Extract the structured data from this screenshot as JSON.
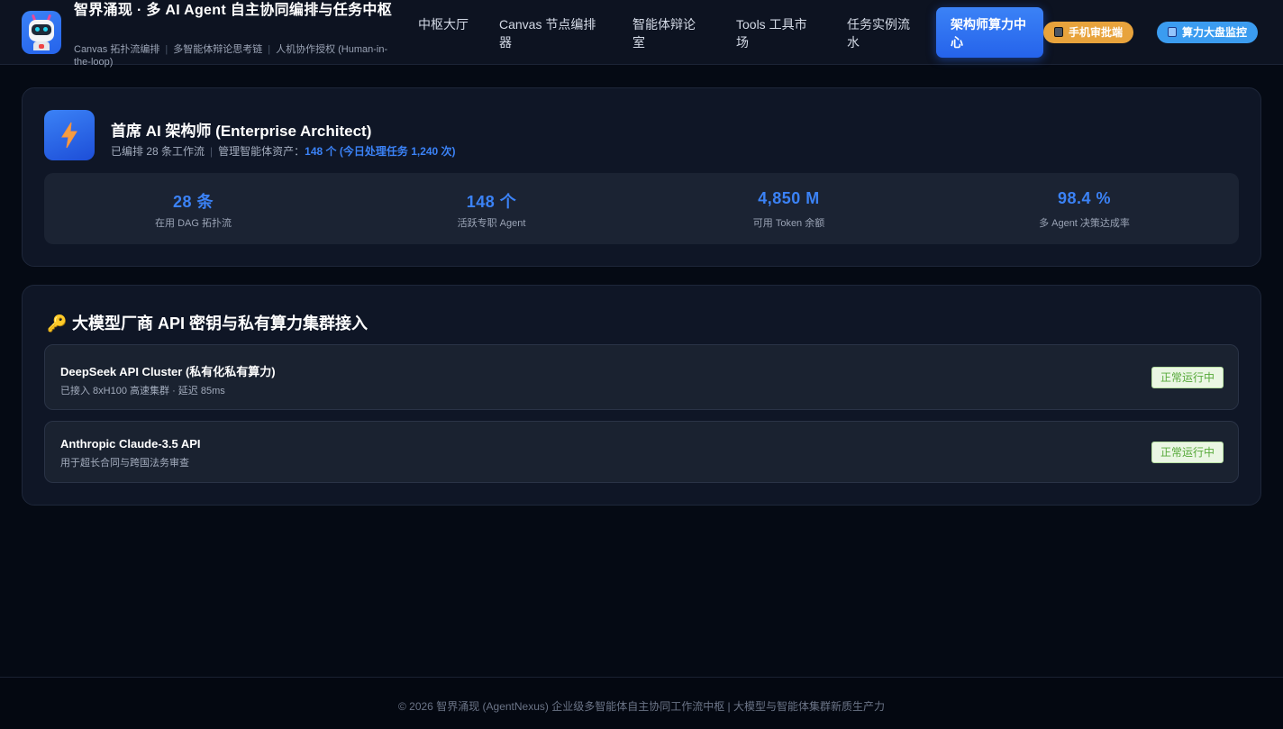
{
  "header": {
    "brand_title": "智界涌现 · 多 AI Agent 自主协同编排与任务中枢",
    "brand_sub": [
      "Canvas 拓扑流编排",
      "多智能体辩论思考链",
      "人机协作授权 (Human-in-the-loop)"
    ],
    "nav": [
      "中枢大厅",
      "Canvas 节点编排器",
      "智能体辩论室",
      "Tools 工具市场",
      "任务实例流水",
      "架构师算力中心"
    ],
    "active_nav": "架构师算力中心",
    "mobile_button": "手机审批端",
    "dashboard_button": "算力大盘监控"
  },
  "profile": {
    "title": "首席 AI 架构师 (Enterprise Architect)",
    "workflows": "已编排 28 条工作流",
    "assets_label": "管理智能体资产：",
    "assets_value": "148 个 (今日处理任务 1,240 次)",
    "icon": "lightning-icon"
  },
  "stats": [
    {
      "value": "28 条",
      "label": "在用 DAG 拓扑流"
    },
    {
      "value": "148 个",
      "label": "活跃专职 Agent"
    },
    {
      "value": "4,850 M",
      "label": "可用 Token 余额"
    },
    {
      "value": "98.4 %",
      "label": "多 Agent 决策达成率"
    }
  ],
  "api_section": {
    "title": "大模型厂商 API 密钥与私有算力集群接入",
    "items": [
      {
        "name": "DeepSeek API Cluster (私有化私有算力)",
        "desc": "已接入 8xH100 高速集群 · 延迟 85ms",
        "status": "正常运行中"
      },
      {
        "name": "Anthropic Claude-3.5 API",
        "desc": "用于超长合同与跨国法务审查",
        "status": "正常运行中"
      }
    ]
  },
  "footer": {
    "text": "© 2026 智界涌现 (AgentNexus) 企业级多智能体自主协同工作流中枢 | 大模型与智能体集群新质生产力"
  },
  "colors": {
    "accent": "#3b82f6",
    "orange": "#e8a33c",
    "status_green": "#57a93a"
  }
}
